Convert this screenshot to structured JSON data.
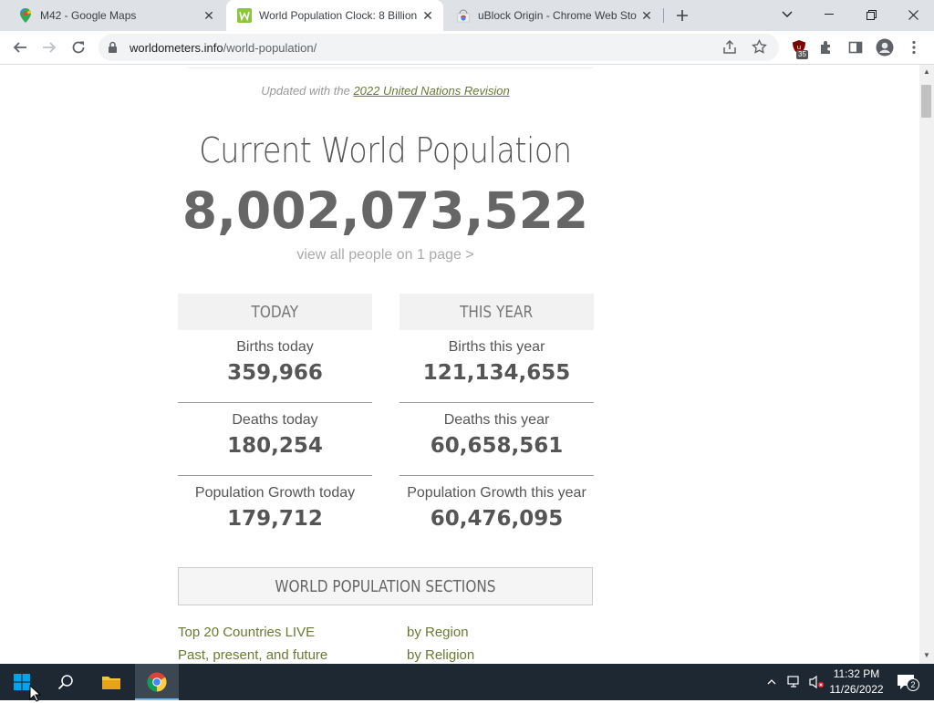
{
  "browser": {
    "tabs": [
      {
        "title": "M42 - Google Maps",
        "icon": "google-maps-icon",
        "active": false
      },
      {
        "title": "World Population Clock: 8 Billion",
        "icon": "worldometers-icon",
        "active": true
      },
      {
        "title": "uBlock Origin - Chrome Web Sto",
        "icon": "chrome-web-store-icon",
        "active": false
      }
    ],
    "address_domain": "worldometers.info",
    "address_path": "/world-population/",
    "extension_badge": "35"
  },
  "page": {
    "updated_prefix": "Updated with the",
    "updated_link": "2022 United Nations Revision",
    "title": "Current World Population",
    "counter": "8,002,073,522",
    "view_all": "view all people on 1 page >",
    "today": {
      "header": "TODAY",
      "stats": [
        {
          "label": "Births today",
          "value": "359,966"
        },
        {
          "label": "Deaths today",
          "value": "180,254"
        },
        {
          "label": "Population Growth today",
          "value": "179,712"
        }
      ]
    },
    "this_year": {
      "header": "THIS YEAR",
      "stats": [
        {
          "label": "Births this year",
          "value": "121,134,655"
        },
        {
          "label": "Deaths this year",
          "value": "60,658,561"
        },
        {
          "label": "Population Growth this year",
          "value": "60,476,095"
        }
      ]
    },
    "sections_header": "WORLD POPULATION SECTIONS",
    "section_links": [
      "Top 20 Countries LIVE",
      "by Region",
      "Past, present, and future",
      "by Religion"
    ]
  },
  "taskbar": {
    "time": "11:32 PM",
    "date": "11/26/2022",
    "notification_count": "2"
  },
  "colors": {
    "link_olive": "#6a7a35",
    "taskbar_bg": "#1e2832",
    "tabstrip_bg": "#dee1e6"
  }
}
